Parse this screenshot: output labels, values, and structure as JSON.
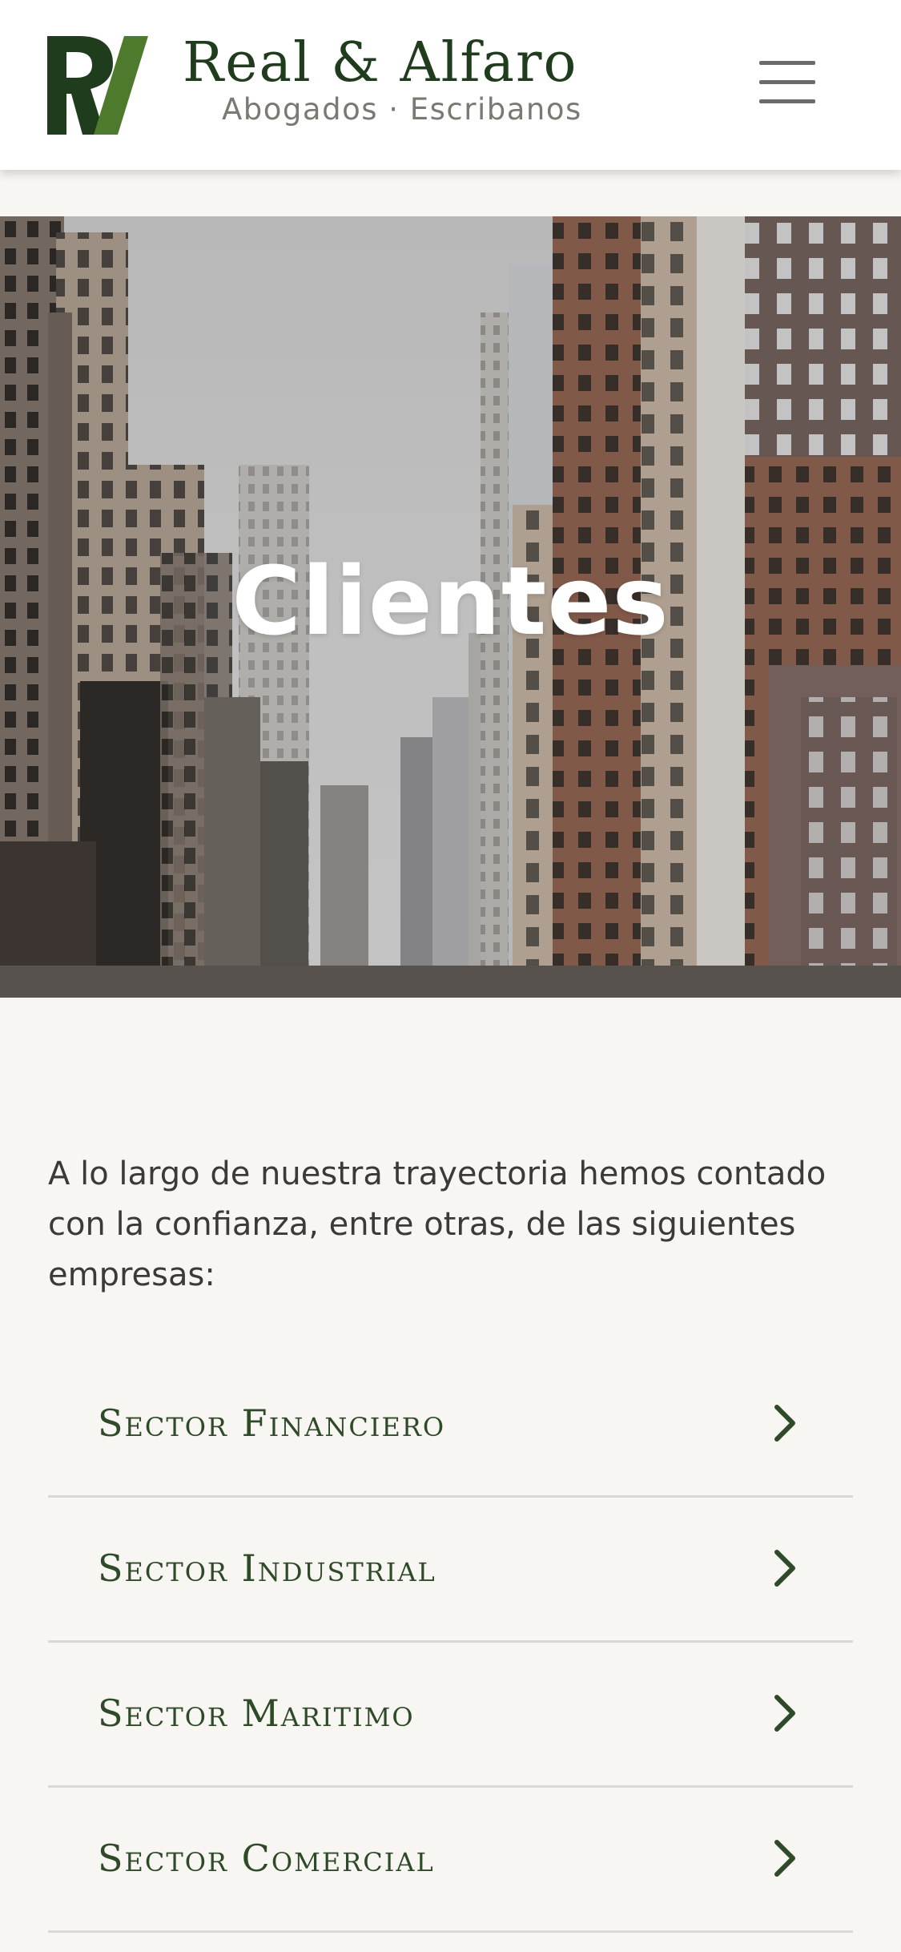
{
  "header": {
    "brand_name": "Real & Alfaro",
    "brand_subtitle": "Abogados · Escribanos",
    "logo_icon": "rv-monogram-logo",
    "menu_icon": "hamburger-menu-icon"
  },
  "hero": {
    "title": "Clientes"
  },
  "intro": {
    "text": "A lo largo de nuestra trayectoria hemos contado con la confianza, entre otras, de las siguientes empresas:"
  },
  "sectors": [
    {
      "label": "Sector Financiero"
    },
    {
      "label": "Sector Industrial"
    },
    {
      "label": "Sector Maritimo"
    },
    {
      "label": "Sector Comercial"
    }
  ],
  "colors": {
    "brand_dark_green": "#1f3d1c",
    "brand_light_green": "#4e7a2e",
    "sector_text": "#2f4a28",
    "page_background": "#f7f6f3"
  }
}
